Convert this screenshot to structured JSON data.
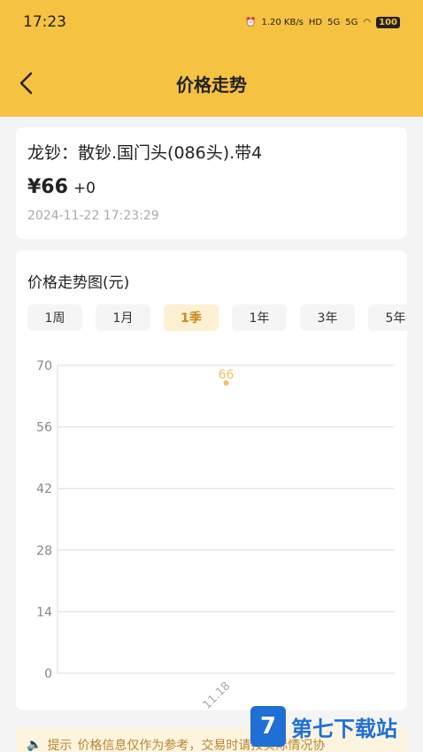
{
  "status": {
    "time": "17:23",
    "speed": "1.20 KB/s",
    "hd": "HD",
    "net1": "5G",
    "net2": "5G",
    "battery": "100"
  },
  "nav": {
    "title": "价格走势"
  },
  "product": {
    "name": "龙钞：散钞.国门头(086头).带4",
    "price": "¥66",
    "change": "+0",
    "date": "2024-11-22 17:23:29"
  },
  "chart_section": {
    "title": "价格走势图(元)",
    "periods": [
      "1周",
      "1月",
      "1季",
      "1年",
      "3年",
      "5年"
    ],
    "active_period": "1季"
  },
  "tip": {
    "label": "提示",
    "text": "价格信息仅作为参考，交易时请按实际情况协"
  },
  "watermark": {
    "text": "第七下载站",
    "logo": "7"
  },
  "colors": {
    "accent": "#f5c242",
    "point": "#f0c15a"
  },
  "chart_data": {
    "type": "line",
    "x": [
      "11.18"
    ],
    "series": [
      {
        "values": [
          66
        ]
      }
    ],
    "data_labels": [
      "66"
    ],
    "yticks": [
      0,
      14,
      28,
      42,
      56,
      70
    ],
    "ylim": [
      0,
      70
    ],
    "grid": true
  }
}
